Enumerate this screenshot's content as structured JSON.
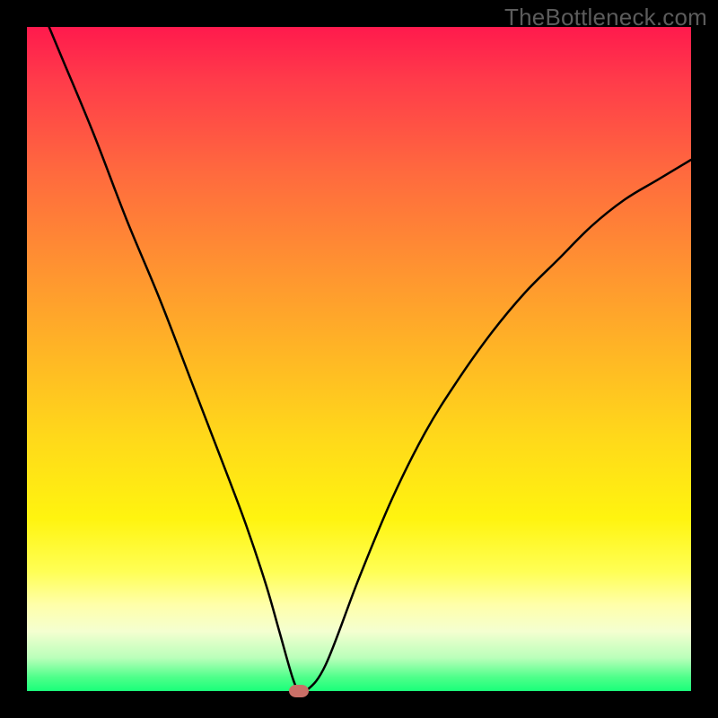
{
  "watermark": "TheBottleneck.com",
  "colors": {
    "frame": "#000000",
    "gradient_top": "#ff1a4d",
    "gradient_bottom": "#1aff7a",
    "curve": "#000000",
    "marker": "#c96f67"
  },
  "chart_data": {
    "type": "line",
    "title": "",
    "xlabel": "",
    "ylabel": "",
    "xlim": [
      0,
      100
    ],
    "ylim": [
      0,
      100
    ],
    "grid": false,
    "legend": false,
    "series": [
      {
        "name": "bottleneck-curve",
        "x": [
          0,
          5,
          10,
          15,
          20,
          25,
          30,
          33,
          36,
          38,
          40,
          41,
          42,
          45,
          50,
          55,
          60,
          65,
          70,
          75,
          80,
          85,
          90,
          95,
          100
        ],
        "y": [
          108,
          96,
          84,
          71,
          59,
          46,
          33,
          25,
          16,
          9,
          2,
          0,
          0,
          4,
          17,
          29,
          39,
          47,
          54,
          60,
          65,
          70,
          74,
          77,
          80
        ]
      }
    ],
    "marker": {
      "x": 41,
      "y": 0
    }
  }
}
